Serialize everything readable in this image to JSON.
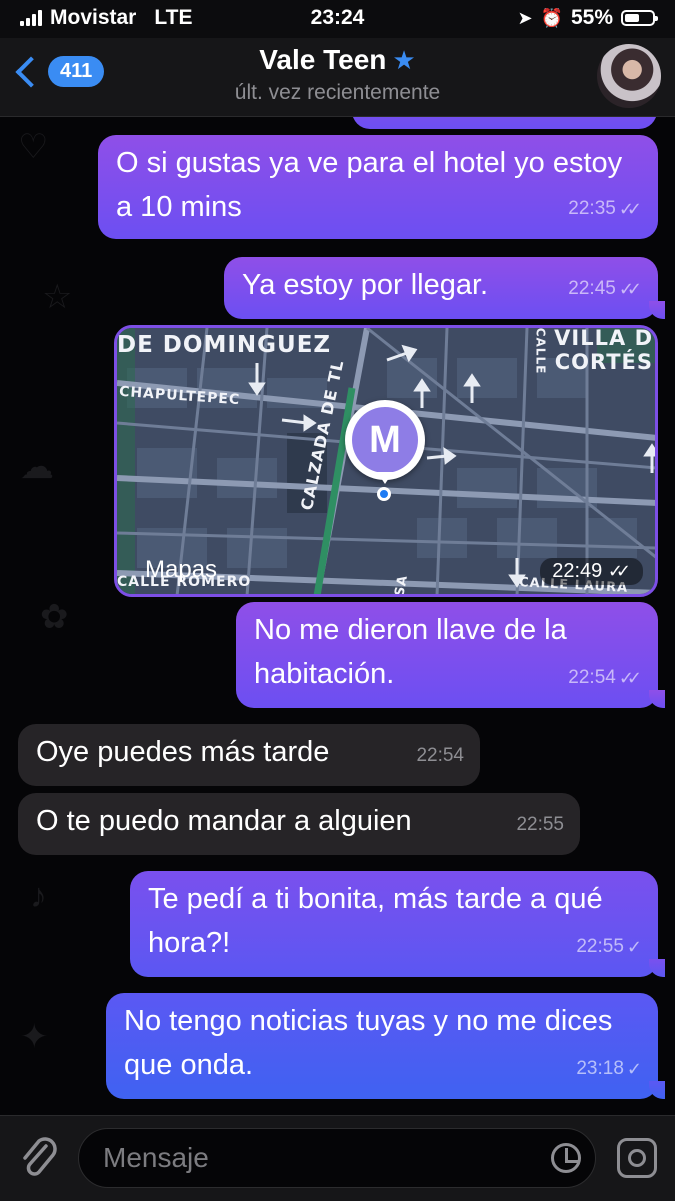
{
  "status": {
    "carrier": "Movistar",
    "network": "LTE",
    "time": "23:24",
    "battery": "55%",
    "battery_level": 0.55
  },
  "header": {
    "back_count": "411",
    "contact_name": "Vale Teen",
    "last_seen": "últ. vez recientemente"
  },
  "messages": [
    {
      "text": "O si gustas ya ve para el hotel yo estoy a 10 mins",
      "time": "22:35",
      "status": "read"
    },
    {
      "text": "Ya estoy por llegar.",
      "time": "22:45",
      "status": "read"
    },
    {
      "text": "No me dieron llave de la habitación.",
      "time": "22:54",
      "status": "read"
    },
    {
      "text": "Oye puedes más tarde",
      "time": "22:54"
    },
    {
      "text": "O te puedo mandar a alguien",
      "time": "22:55"
    },
    {
      "text": "Te pedí a ti bonita, más tarde a qué hora?!",
      "time": "22:55",
      "status": "sent"
    },
    {
      "text": "No tengo noticias tuyas y no me dices que onda.",
      "time": "23:18",
      "status": "sent"
    }
  ],
  "map": {
    "labels": {
      "top_left": "DE DOMINGUEZ",
      "top_right_1": "VILLA D",
      "top_right_2": "CORTÉS",
      "left_street": "CHAPULTEPEC",
      "diag_street": "CALZADA DE TL",
      "bottom_left": "CALLE ROMERO",
      "bottom_right": "CALLE LAURA",
      "calle": "CALLE",
      "sa": "SA"
    },
    "pin_letter": "M",
    "brand": "Mapas",
    "time": "22:49",
    "status": "read"
  },
  "input": {
    "placeholder": "Mensaje"
  },
  "icons": {
    "attach": "paperclip-icon",
    "sticker": "sticker-icon",
    "camera": "camera-icon",
    "star": "star-icon"
  },
  "colors": {
    "accent": "#3a8cf3",
    "bubble_out_top": "#8f4fe8",
    "bubble_out_bottom": "#6c4ff2",
    "bubble_in": "#262427"
  }
}
